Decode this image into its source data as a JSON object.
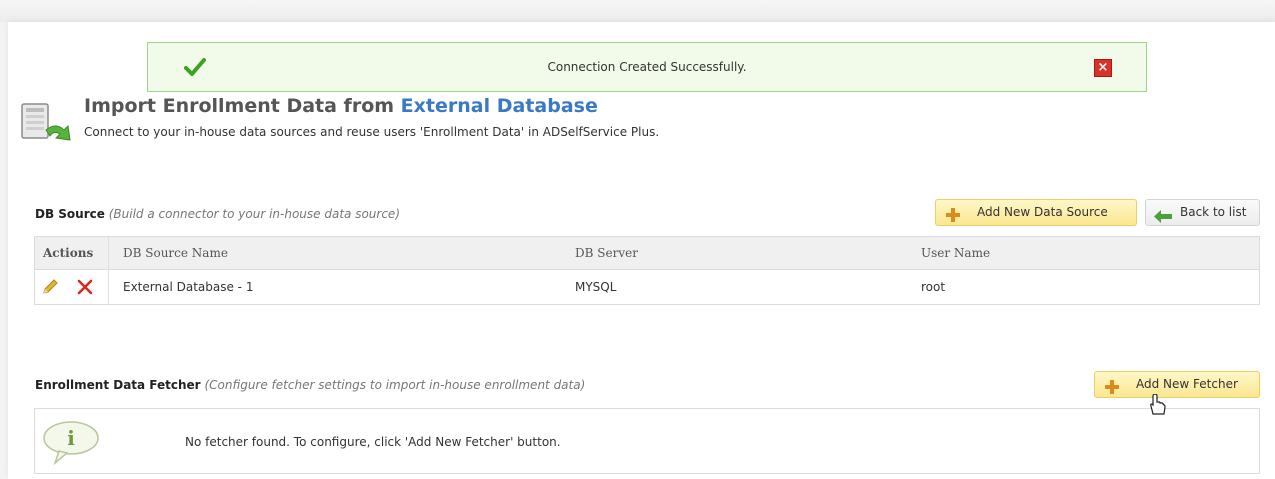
{
  "banner": {
    "message": "Connection Created Successfully.",
    "close_label": "×"
  },
  "header": {
    "title_prefix": "Import Enrollment Data from ",
    "title_highlight": "External Database",
    "subtitle": "Connect to your in-house data sources and reuse users 'Enrollment Data' in ADSelfService Plus."
  },
  "db_source": {
    "label": "DB Source",
    "hint": "(Build a connector to your in-house data source)",
    "add_button": "Add New Data Source",
    "back_button": "Back to list",
    "columns": [
      "Actions",
      "DB Source Name",
      "DB Server",
      "User Name"
    ],
    "rows": [
      {
        "name": "External Database - 1",
        "server": "MYSQL",
        "user": "root"
      }
    ]
  },
  "fetcher": {
    "label": "Enrollment Data Fetcher",
    "hint": "(Configure fetcher settings to import in-house enrollment data)",
    "add_button": "Add New Fetcher",
    "empty_message": "No fetcher found. To configure, click 'Add New Fetcher' button."
  },
  "colors": {
    "accent": "#3a79c6",
    "success_bg": "#f2fbe9",
    "success_border": "#9fd58a",
    "button_yellow": "#fbe790",
    "close_red": "#d8322b"
  }
}
